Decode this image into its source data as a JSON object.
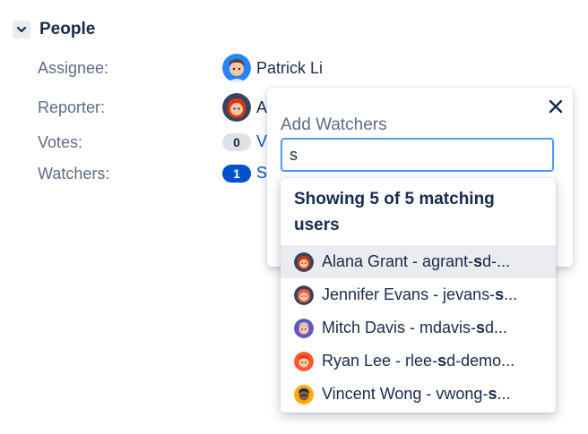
{
  "section": {
    "title": "People",
    "toggle_icon": "chevron-down-icon"
  },
  "fields": {
    "assignee": {
      "label": "Assignee:",
      "name": "Patrick Li"
    },
    "reporter": {
      "label": "Reporter:",
      "name_fragment": "A"
    },
    "votes": {
      "label": "Votes:",
      "count": "0",
      "link_fragment": "V"
    },
    "watchers": {
      "label": "Watchers:",
      "count": "1",
      "link_fragment": "S"
    }
  },
  "popup": {
    "title": "Add Watchers",
    "close_icon": "close-icon",
    "search": {
      "value": "s",
      "placeholder": ""
    }
  },
  "dropdown": {
    "heading": "Showing 5 of 5 matching users",
    "options": [
      {
        "pre": "Alana Grant - agrant-",
        "bold": "s",
        "post": "d-...",
        "avatar": "red",
        "active": true
      },
      {
        "pre": "Jennifer Evans - jevans-",
        "bold": "s",
        "post": "...",
        "avatar": "red",
        "active": false
      },
      {
        "pre": "Mitch Davis - mdavis-",
        "bold": "s",
        "post": "d...",
        "avatar": "purple",
        "active": false
      },
      {
        "pre": "Ryan Lee - rlee-",
        "bold": "s",
        "post": "d-demo...",
        "avatar": "orange",
        "active": false
      },
      {
        "pre": "Vincent Wong - vwong-",
        "bold": "s",
        "post": "...",
        "avatar": "yellow",
        "active": false
      }
    ]
  },
  "colors": {
    "link": "#0052CC",
    "focus": "#4C9AFF",
    "label": "#5E6C84",
    "text": "#172B4D"
  }
}
